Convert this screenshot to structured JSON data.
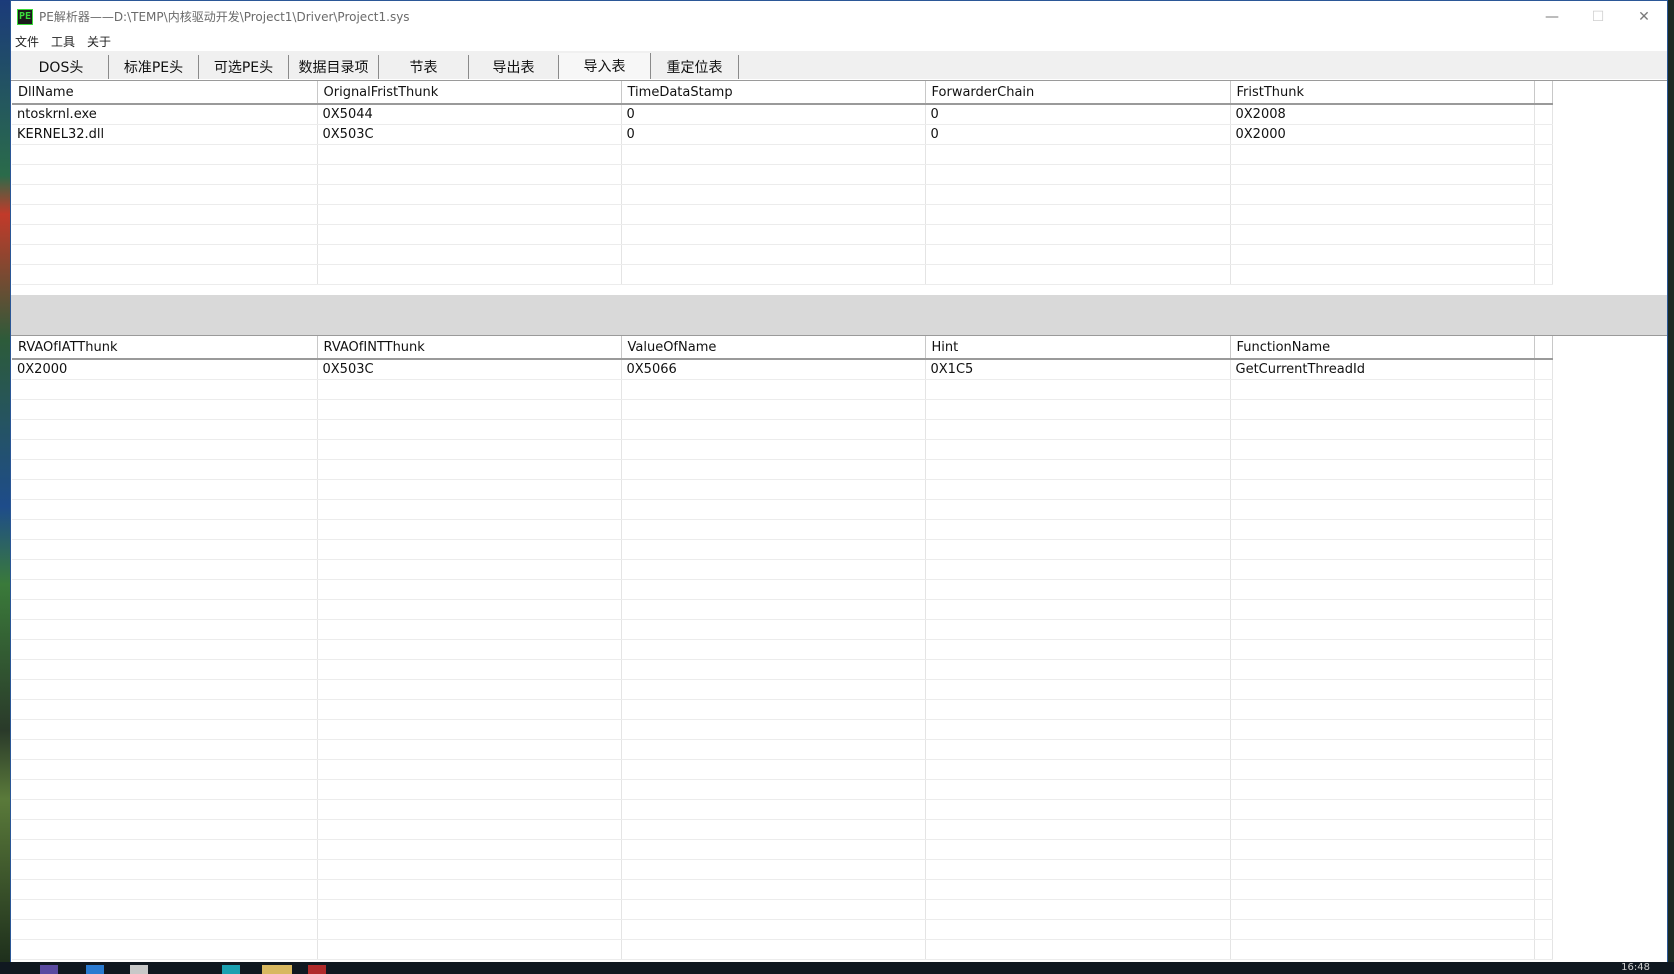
{
  "window": {
    "icon_text": "PE",
    "title": "PE解析器——D:\\TEMP\\内核驱动开发\\Project1\\Driver\\Project1.sys",
    "minimize": "—",
    "maximize": "☐",
    "close": "✕"
  },
  "menu": [
    "文件",
    "工具",
    "关于"
  ],
  "tabs": [
    {
      "label": "DOS头",
      "active": false
    },
    {
      "label": "标准PE头",
      "active": false
    },
    {
      "label": "可选PE头",
      "active": false
    },
    {
      "label": "数据目录项",
      "active": false
    },
    {
      "label": "节表",
      "active": false
    },
    {
      "label": "导出表",
      "active": false
    },
    {
      "label": "导入表",
      "active": true
    },
    {
      "label": "重定位表",
      "active": false
    }
  ],
  "import_table": {
    "columns": [
      "DllName",
      "OrignalFristThunk",
      "TimeDataStamp",
      "ForwarderChain",
      "FristThunk"
    ],
    "rows": [
      [
        "ntoskrnl.exe",
        "0X5044",
        "0",
        "0",
        "0X2008"
      ],
      [
        "KERNEL32.dll",
        "0X503C",
        "0",
        "0",
        "0X2000"
      ]
    ]
  },
  "function_table": {
    "columns": [
      "RVAOfIATThunk",
      "RVAOfINTThunk",
      "ValueOfName",
      "Hint",
      "FunctionName"
    ],
    "rows": [
      [
        "0X2000",
        "0X503C",
        "0X5066",
        "0X1C5",
        "GetCurrentThreadId"
      ]
    ]
  },
  "taskbar": {
    "clock": "16:48"
  }
}
